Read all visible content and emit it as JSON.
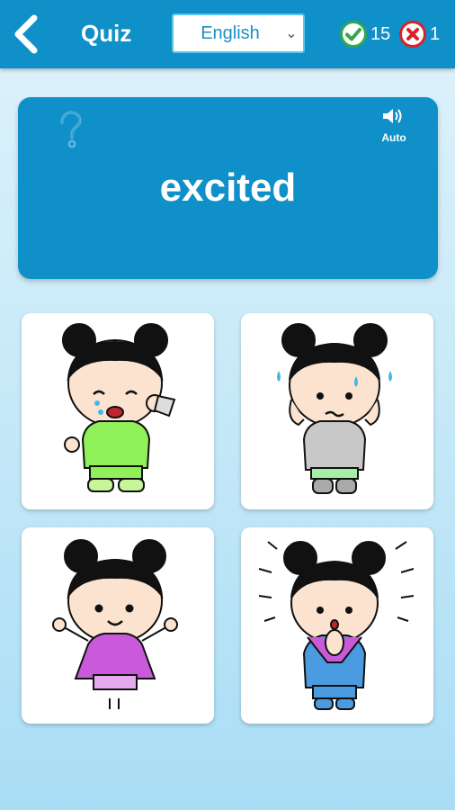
{
  "header": {
    "title": "Quiz",
    "language": "English",
    "correct_count": "15",
    "wrong_count": "1"
  },
  "word_card": {
    "word": "excited",
    "audio_label": "Auto"
  },
  "options": [
    {
      "emotion": "crying",
      "shirt_color": "#8ff05a"
    },
    {
      "emotion": "worried",
      "shirt_color": "#c8c8c8"
    },
    {
      "emotion": "happy-jumping",
      "shirt_color": "#c95ad9"
    },
    {
      "emotion": "excited",
      "shirt_color": "#4a9be0"
    }
  ],
  "colors": {
    "accent": "#0f90c8",
    "correct": "#2fa84f",
    "wrong": "#d8222a"
  }
}
